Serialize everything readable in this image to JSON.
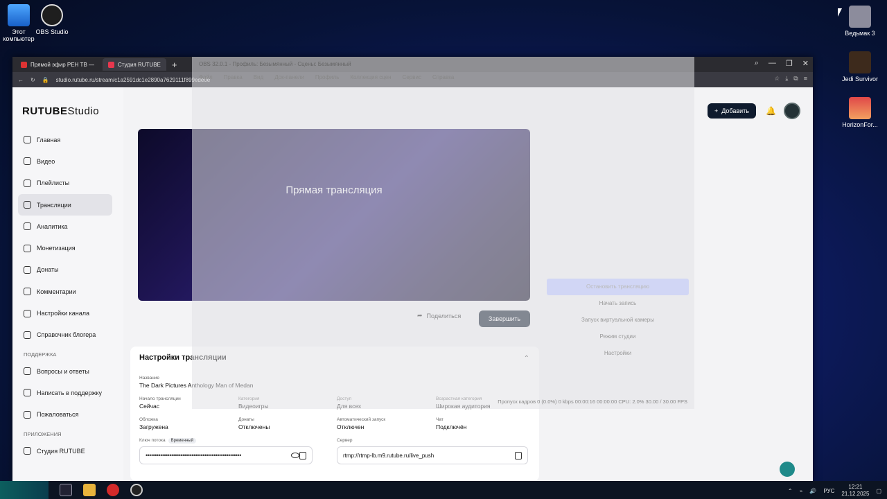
{
  "desktop": {
    "icons_left": [
      {
        "label": "Этот компьютер"
      },
      {
        "label": "OBS Studio"
      }
    ],
    "icons_right": [
      {
        "label": "Ведьмак 3"
      },
      {
        "label": "Jedi Survivor"
      },
      {
        "label": "HorizonFor..."
      }
    ]
  },
  "browser": {
    "tabs": [
      {
        "label": "Прямой эфир РЕН ТВ —"
      },
      {
        "label": "Студия RUTUBE"
      }
    ],
    "url": "studio.rutube.ru/stream/c1a2591dc1e2890a7629111f899ede0e"
  },
  "app": {
    "logo_main": "RUTUBE",
    "logo_studio": "Studio",
    "add_button": "Добавить",
    "nav": [
      {
        "label": "Главная"
      },
      {
        "label": "Видео"
      },
      {
        "label": "Плейлисты"
      },
      {
        "label": "Трансляции"
      },
      {
        "label": "Аналитика"
      },
      {
        "label": "Монетизация"
      },
      {
        "label": "Донаты"
      },
      {
        "label": "Комментарии"
      },
      {
        "label": "Настройки канала"
      },
      {
        "label": "Справочник блогера"
      }
    ],
    "support_header": "Поддержка",
    "support": [
      {
        "label": "Вопросы и ответы"
      },
      {
        "label": "Написать в поддержку"
      },
      {
        "label": "Пожаловаться"
      }
    ],
    "apps_header": "Приложения",
    "apps_item": "Студия RUTUBE",
    "player_title": "Прямая трансляция",
    "share_label": "Поделиться",
    "end_label": "Завершить",
    "settings": {
      "title": "Настройки трансляции",
      "name_label": "Название",
      "name_value": "The Dark Pictures Anthology Man of Medan",
      "start_label": "Начало трансляции",
      "start_value": "Сейчас",
      "category_label": "Категория",
      "category_value": "Видеоигры",
      "access_label": "Доступ",
      "access_value": "Для всех",
      "age_label": "Возрастная категория",
      "age_value": "Широкая аудитория",
      "cover_label": "Обложка",
      "cover_value": "Загружена",
      "donate_label": "Донаты",
      "donate_value": "Отключены",
      "autostart_label": "Автоматический запуск",
      "autostart_value": "Отключен",
      "chat_label": "Чат",
      "chat_value": "Подключён",
      "key_label": "Ключ потока",
      "key_tag": "Временный",
      "key_value": "••••••••••••••••••••••••••••••••••••••••••••••••••••",
      "server_label": "Сервер",
      "server_value": "rtmp://rtmp-lb.m9.rutube.ru/live_push"
    }
  },
  "obs": {
    "title": "OBS 32.0.1 - Профиль: Безымянный - Сцены: Безымянный",
    "menu": [
      "Файл",
      "Правка",
      "Вид",
      "Док-панели",
      "Профиль",
      "Коллекция сцен",
      "Сервис",
      "Справка"
    ],
    "controls": [
      "Остановить трансляцию",
      "Начать запись",
      "Запуск виртуальной камеры",
      "Режим студии",
      "Настройки"
    ],
    "status": "Пропуск кадров 0 (0.0%)  0 kbps  00:00:16  00:00:00  CPU: 2.0%  30.00 / 30.00 FPS"
  },
  "taskbar": {
    "lang": "РУС",
    "time": "12:21",
    "date": "21.12.2025"
  }
}
